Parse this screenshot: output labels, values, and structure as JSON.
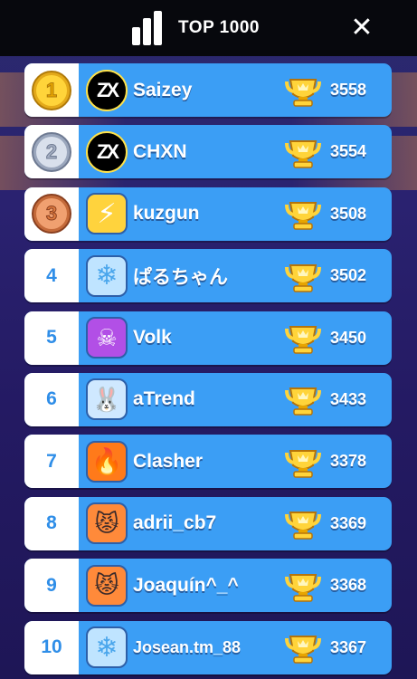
{
  "header": {
    "title": "TOP 1000",
    "icon": "leaderboard-bars-icon",
    "close_label": "✕"
  },
  "colors": {
    "row_blue": "#3b9ef5",
    "rank_text": "#2f8ee8",
    "header_bg": "#07080d"
  },
  "players": [
    {
      "rank": "1",
      "medal": "gold",
      "avatar": "zx-logo-icon",
      "name": "Saizey",
      "score": "3558"
    },
    {
      "rank": "2",
      "medal": "silver",
      "avatar": "zx-logo-icon",
      "name": "CHXN",
      "score": "3554"
    },
    {
      "rank": "3",
      "medal": "bronze",
      "avatar": "lightning-bolt-icon",
      "name": "kuzgun",
      "score": "3508"
    },
    {
      "rank": "4",
      "medal": "",
      "avatar": "snowflake-icon",
      "name": "ぱるちゃん",
      "score": "3502"
    },
    {
      "rank": "5",
      "medal": "",
      "avatar": "ghost-skull-icon",
      "name": "Volk",
      "score": "3450"
    },
    {
      "rank": "6",
      "medal": "",
      "avatar": "bunny-icon",
      "name": "aTrend",
      "score": "3433"
    },
    {
      "rank": "7",
      "medal": "",
      "avatar": "fire-icon",
      "name": "Clasher",
      "score": "3378"
    },
    {
      "rank": "8",
      "medal": "",
      "avatar": "angry-cat-icon",
      "name": "adrii_cb7",
      "score": "3369"
    },
    {
      "rank": "9",
      "medal": "",
      "avatar": "angry-cat-icon",
      "name": "Joaquín^_^",
      "score": "3368"
    },
    {
      "rank": "10",
      "medal": "",
      "avatar": "snowflake-icon",
      "name": "Josean.tm_88",
      "score": "3367"
    }
  ]
}
